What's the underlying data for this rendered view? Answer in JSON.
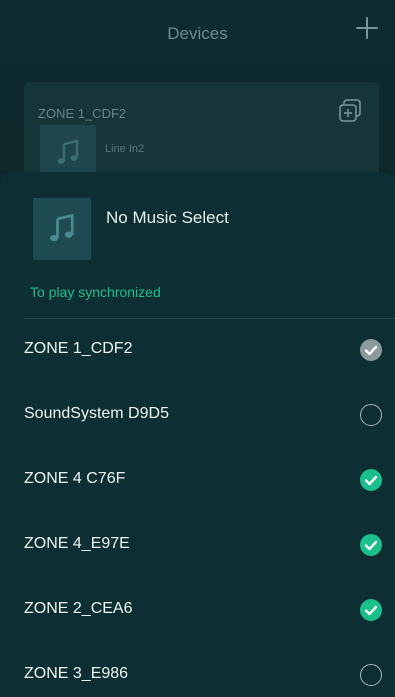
{
  "header": {
    "title": "Devices",
    "add_icon": "plus-icon"
  },
  "background_card": {
    "zone_name": "ZONE 1_CDF2",
    "source": "Line In2",
    "group_icon": "group-add-icon"
  },
  "now_playing": {
    "title": "No Music Select",
    "art_icon": "music-note-icon"
  },
  "sync": {
    "label": "To play synchronized"
  },
  "devices": [
    {
      "name": "ZONE 1_CDF2",
      "state": "locked"
    },
    {
      "name": "SoundSystem D9D5",
      "state": "unselected"
    },
    {
      "name": "ZONE 4 C76F",
      "state": "selected"
    },
    {
      "name": "ZONE 4_E97E",
      "state": "selected"
    },
    {
      "name": "ZONE 2_CEA6",
      "state": "selected"
    },
    {
      "name": "ZONE 3_E986",
      "state": "unselected"
    }
  ],
  "colors": {
    "accent": "#1bbf8a",
    "sheet": "#0d2f33",
    "locked": "#8c9a9b"
  }
}
